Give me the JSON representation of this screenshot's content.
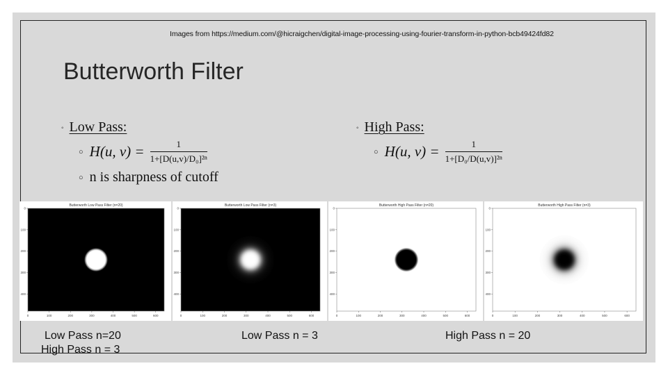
{
  "slide": {
    "credit": "Images from https://medium.com/@hicraigchen/digital-image-processing-using-fourier-transform-in-python-bcb49424fd82",
    "title": "Butterworth Filter",
    "low_pass": {
      "heading": "Low Pass:",
      "formula_lhs": "H(u, v) =",
      "formula_numerator": "1",
      "formula_denominator": "1+[D(u,v)/D₀]²ⁿ",
      "note": "n is sharpness of cutoff"
    },
    "high_pass": {
      "heading": "High Pass:",
      "formula_lhs": "H(u, v) =",
      "formula_numerator": "1",
      "formula_denominator": "1+[D₀/D(u,v)]²ⁿ"
    }
  },
  "panels": [
    {
      "title": "Butterworth Low Pass Filter (n=20)",
      "type": "low",
      "n": 20,
      "background": "#000000",
      "foreground": "#ffffff"
    },
    {
      "title": "Butterworth Low Pass Filter (n=3)",
      "type": "low",
      "n": 3,
      "background": "#000000",
      "foreground": "#ffffff"
    },
    {
      "title": "Butterworth High Pass Filter (n=20)",
      "type": "high",
      "n": 20,
      "background": "#ffffff",
      "foreground": "#000000"
    },
    {
      "title": "Butterworth High Pass Filter (n=3)",
      "type": "high",
      "n": 3,
      "background": "#ffffff",
      "foreground": "#000000"
    }
  ],
  "axes": {
    "x_ticks": [
      "0",
      "100",
      "200",
      "300",
      "400",
      "500",
      "600"
    ],
    "y_ticks": [
      "0",
      "100",
      "200",
      "300",
      "400"
    ]
  },
  "captions": {
    "c1_line1": "Low Pass n=20",
    "c1_line2": "High Pass n = 3",
    "c2": "Low Pass  n = 3",
    "c3": "High Pass n = 20"
  }
}
